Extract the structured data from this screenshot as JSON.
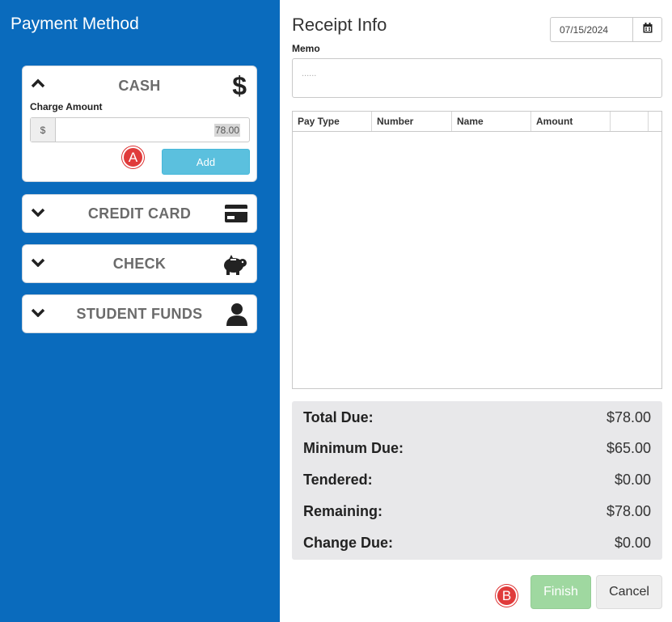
{
  "payment_method": {
    "title": "Payment Method",
    "cash": {
      "title": "CASH",
      "icon": "dollar-icon",
      "icon_glyph": "$",
      "charge_label": "Charge Amount",
      "currency_addon": "$",
      "amount_value": "78.00",
      "add_label": "Add",
      "marker": "A"
    },
    "credit_card": {
      "title": "CREDIT CARD",
      "icon": "credit-card-icon"
    },
    "check": {
      "title": "CHECK",
      "icon": "piggy-bank-icon"
    },
    "student_funds": {
      "title": "STUDENT FUNDS",
      "icon": "user-icon"
    }
  },
  "receipt": {
    "title": "Receipt Info",
    "date_value": "07/15/2024",
    "memo_label": "Memo",
    "memo_placeholder": "......",
    "columns": [
      "Pay Type",
      "Number",
      "Name",
      "Amount",
      "",
      ""
    ],
    "rows": []
  },
  "totals": {
    "total_due_label": "Total Due:",
    "total_due": "$78.00",
    "minimum_due_label": "Minimum Due:",
    "minimum_due": "$65.00",
    "tendered_label": "Tendered:",
    "tendered": "$0.00",
    "remaining_label": "Remaining:",
    "remaining": "$78.00",
    "change_due_label": "Change Due:",
    "change_due": "$0.00"
  },
  "actions": {
    "finish_label": "Finish",
    "cancel_label": "Cancel",
    "marker": "B"
  },
  "colors": {
    "left_panel": "#0a6bbd",
    "add_button": "#5bc0de",
    "finish_button": "#9fd8a0",
    "marker": "#e03b3b"
  }
}
